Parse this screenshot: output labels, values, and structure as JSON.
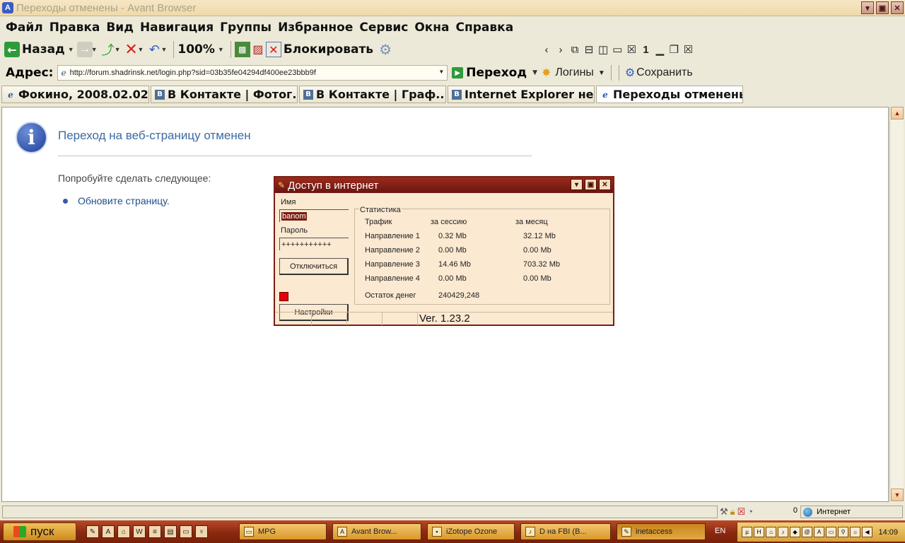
{
  "window": {
    "title": "Переходы отменены - Avant Browser"
  },
  "menu": [
    "Файл",
    "Правка",
    "Вид",
    "Навигация",
    "Группы",
    "Избранное",
    "Сервис",
    "Окна",
    "Справка"
  ],
  "toolbar": {
    "back_label": "Назад",
    "zoom": "100%",
    "block_label": "Блокировать"
  },
  "navtool": {
    "page_number": "1"
  },
  "address": {
    "label": "Адрес:",
    "url": "http://forum.shadrinsk.net/login.php?sid=03b35fe04294df400ee23bbb9f",
    "go_label": "Переход"
  },
  "rightbar": {
    "logins_label": "Логины",
    "save_label": "Сохранить"
  },
  "tabs": [
    {
      "label": "Фокино, 2008.02.02",
      "icon": "page-icon"
    },
    {
      "label": "В Контакте | Фотог...",
      "icon": "vk-icon"
    },
    {
      "label": "В Контакте | Граф...",
      "icon": "vk-icon"
    },
    {
      "label": "Internet Explorer не...",
      "icon": "vk-icon"
    },
    {
      "label": "Переходы отменены",
      "icon": "ie-icon"
    }
  ],
  "page": {
    "title": "Переход на веб-страницу отменен",
    "try_text": "Попробуйте сделать следующее:",
    "refresh_link": "Обновите страницу."
  },
  "dialog": {
    "title": "Доступ в интернет",
    "name_label": "Имя",
    "name_value": "banom",
    "password_label": "Пароль",
    "password_value": "+++++++++++",
    "disconnect_label": "Отключиться",
    "settings_label": "Настройки",
    "stats_legend": "Статистика",
    "col_traffic": "Трафик",
    "col_session": "за сессию",
    "col_month": "за месяц",
    "rows": [
      {
        "dir": "Направление 1",
        "session": "0.32 Mb",
        "month": "32.12 Mb"
      },
      {
        "dir": "Направление 2",
        "session": "0.00 Mb",
        "month": "0.00 Mb"
      },
      {
        "dir": "Направление 3",
        "session": "14.46 Mb",
        "month": "703.32 Mb"
      },
      {
        "dir": "Направление 4",
        "session": "0.00 Mb",
        "month": "0.00 Mb"
      }
    ],
    "balance_label": "Остаток денег",
    "balance_value": "240429,248",
    "version": "Ver. 1.23.2",
    "status_color": "#e6000a"
  },
  "statusbar": {
    "count": "0",
    "zone": "Интернет"
  },
  "taskbar": {
    "start_label": "пуск",
    "tasks": [
      "MPG",
      "Avant Brow...",
      "iZotope Ozone",
      "D на FBI (B...",
      "inetaccess"
    ],
    "lang": "EN",
    "clock": "14:09"
  }
}
